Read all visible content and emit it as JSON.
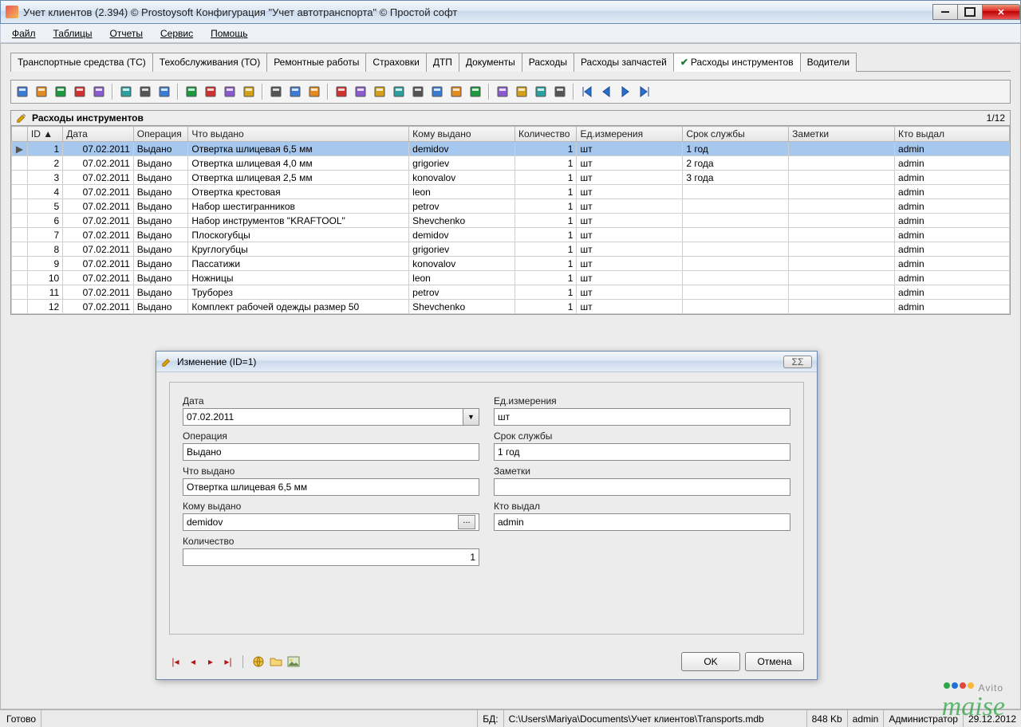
{
  "window": {
    "title": "Учет клиентов (2.394) © Prostoysoft  Конфигурация \"Учет автотранспорта\" © Простой софт"
  },
  "menu": [
    "Файл",
    "Таблицы",
    "Отчеты",
    "Сервис",
    "Помощь"
  ],
  "tabs": [
    "Транспортные средства (ТС)",
    "Техобслуживания (ТО)",
    "Ремонтные работы",
    "Страховки",
    "ДТП",
    "Документы",
    "Расходы",
    "Расходы запчастей",
    "Расходы инструментов",
    "Водители"
  ],
  "tabs_active_index": 8,
  "grid": {
    "title": "Расходы инструментов",
    "counter": "1/12",
    "columns": [
      "ID",
      "Дата",
      "Операция",
      "Что выдано",
      "Кому выдано",
      "Количество",
      "Ед.измерения",
      "Срок службы",
      "Заметки",
      "Кто выдал"
    ],
    "rows": [
      {
        "id": "1",
        "date": "07.02.2011",
        "op": "Выдано",
        "item": "Отвертка шлицевая 6,5 мм",
        "to": "demidov",
        "qty": "1",
        "unit": "шт",
        "life": "1 год",
        "notes": "",
        "issuer": "admin",
        "sel": true
      },
      {
        "id": "2",
        "date": "07.02.2011",
        "op": "Выдано",
        "item": "Отвертка шлицевая 4,0 мм",
        "to": "grigoriev",
        "qty": "1",
        "unit": "шт",
        "life": "2 года",
        "notes": "",
        "issuer": "admin"
      },
      {
        "id": "3",
        "date": "07.02.2011",
        "op": "Выдано",
        "item": "Отвертка шлицевая 2,5 мм",
        "to": "konovalov",
        "qty": "1",
        "unit": "шт",
        "life": "3 года",
        "notes": "",
        "issuer": "admin"
      },
      {
        "id": "4",
        "date": "07.02.2011",
        "op": "Выдано",
        "item": "Отвертка крестовая",
        "to": "leon",
        "qty": "1",
        "unit": "шт",
        "life": "",
        "notes": "",
        "issuer": "admin"
      },
      {
        "id": "5",
        "date": "07.02.2011",
        "op": "Выдано",
        "item": "Набор шестигранников",
        "to": "petrov",
        "qty": "1",
        "unit": "шт",
        "life": "",
        "notes": "",
        "issuer": "admin"
      },
      {
        "id": "6",
        "date": "07.02.2011",
        "op": "Выдано",
        "item": "Набор инструментов \"KRAFTOOL\"",
        "to": "Shevchenko",
        "qty": "1",
        "unit": "шт",
        "life": "",
        "notes": "",
        "issuer": "admin"
      },
      {
        "id": "7",
        "date": "07.02.2011",
        "op": "Выдано",
        "item": "Плоскогубцы",
        "to": "demidov",
        "qty": "1",
        "unit": "шт",
        "life": "",
        "notes": "",
        "issuer": "admin"
      },
      {
        "id": "8",
        "date": "07.02.2011",
        "op": "Выдано",
        "item": "Круглогубцы",
        "to": "grigoriev",
        "qty": "1",
        "unit": "шт",
        "life": "",
        "notes": "",
        "issuer": "admin"
      },
      {
        "id": "9",
        "date": "07.02.2011",
        "op": "Выдано",
        "item": "Пассатижи",
        "to": "konovalov",
        "qty": "1",
        "unit": "шт",
        "life": "",
        "notes": "",
        "issuer": "admin"
      },
      {
        "id": "10",
        "date": "07.02.2011",
        "op": "Выдано",
        "item": "Ножницы",
        "to": "leon",
        "qty": "1",
        "unit": "шт",
        "life": "",
        "notes": "",
        "issuer": "admin"
      },
      {
        "id": "11",
        "date": "07.02.2011",
        "op": "Выдано",
        "item": "Труборез",
        "to": "petrov",
        "qty": "1",
        "unit": "шт",
        "life": "",
        "notes": "",
        "issuer": "admin"
      },
      {
        "id": "12",
        "date": "07.02.2011",
        "op": "Выдано",
        "item": "Комплект рабочей одежды размер 50",
        "to": "Shevchenko",
        "qty": "1",
        "unit": "шт",
        "life": "",
        "notes": "",
        "issuer": "admin"
      }
    ]
  },
  "dialog": {
    "title": "Изменение (ID=1)",
    "labels": {
      "date": "Дата",
      "op": "Операция",
      "item": "Что выдано",
      "to": "Кому выдано",
      "qty": "Количество",
      "unit": "Ед.измерения",
      "life": "Срок службы",
      "notes": "Заметки",
      "issuer": "Кто выдал"
    },
    "values": {
      "date": "07.02.2011",
      "op": "Выдано",
      "item": "Отвертка шлицевая 6,5 мм",
      "to": "demidov",
      "qty": "1",
      "unit": "шт",
      "life": "1 год",
      "notes": "",
      "issuer": "admin"
    },
    "buttons": {
      "ok": "OK",
      "cancel": "Отмена"
    },
    "close_glyph": "ΣΣ"
  },
  "status": {
    "ready": "Готово",
    "db_label": "БД:",
    "db_path": "C:\\Users\\Mariya\\Documents\\Учет клиентов\\Transports.mdb",
    "size": "848 Kb",
    "user": "admin",
    "role": "Администратор",
    "date": "29.12.2012"
  },
  "watermark": "maise",
  "avito": "Avito"
}
